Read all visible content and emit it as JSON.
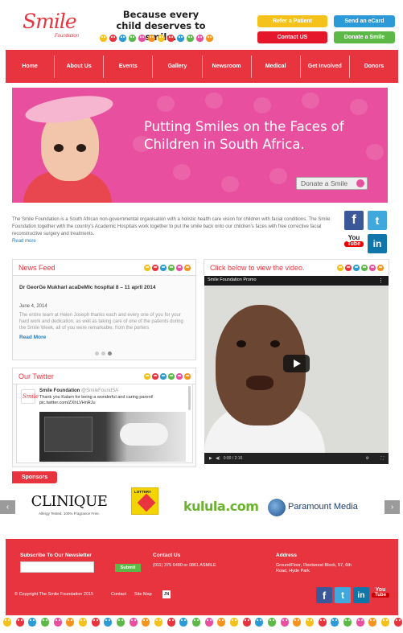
{
  "header": {
    "logo_text": "Smile",
    "logo_sub": "Foundation",
    "tagline": "Because every child deserves to smile.",
    "buttons": [
      {
        "label": "Refer a Patient",
        "color": "#f5c21b"
      },
      {
        "label": "Send an eCard",
        "color": "#2b9ad6"
      },
      {
        "label": "Contact US",
        "color": "#e5172b"
      },
      {
        "label": "Donate a Smile",
        "color": "#5cb947"
      }
    ]
  },
  "nav": {
    "items": [
      "Home",
      "About Us",
      "Events",
      "Gallery",
      "Newsroom",
      "Medical",
      "Get Involved",
      "Donors"
    ]
  },
  "banner": {
    "headline": "Putting Smiles on the Faces of Children in South Africa.",
    "donate_label": "Donate a Smile"
  },
  "intro": {
    "text": "The Smile Foundation is a South African non-governmental organisation with a holistic health care vision for children with facial conditions. The Smile Foundation together with the country's Academic Hospitals work together to put the smile back onto our children's faces with free corrective facial reconstructive surgery and treatments.",
    "read_more": "Read more"
  },
  "social": {
    "facebook": "f",
    "twitter": "t",
    "youtube_top": "You",
    "youtube_bottom": "Tube",
    "linkedin": "in"
  },
  "news_feed": {
    "title": "News Feed",
    "item_title": "Dr GeorGe MukharI acaDeMIc hospItal 8 – 11 aprIl 2014",
    "date": "June 4, 2014",
    "body": "The entire team at Helen Joseph thanks each and every one of you for your hard work and dedication, as well as taking care of one of the patients during the Smile Week, all of you were remarkable, from the porters",
    "read_more": "Read More"
  },
  "twitter": {
    "title": "Our Twitter",
    "account": "Smile Foundation",
    "handle": "@SmileFoundSA",
    "tweet": "Thank you Kalam for being a wonderful and caring parent! pic.twitter.com/ZXhLVHnRJu"
  },
  "video": {
    "panel_title": "Click below to view the video.",
    "video_title": "Smile Foundation Promo",
    "time": "0:00 / 2:16"
  },
  "sponsors": {
    "label": "Sponsors",
    "prev": "‹",
    "next": "›",
    "items": [
      {
        "name": "CLINIQUE",
        "sub": "Allergy Tested. 100% Fragrance Free."
      },
      {
        "name": "LOTTERY",
        "sub": ""
      },
      {
        "name": "kulula.com",
        "sub": ""
      },
      {
        "name": "Paramount Media",
        "sub": ""
      }
    ]
  },
  "footer": {
    "newsletter_title": "Subscribe To Our Newsletter",
    "submit_label": "Submit",
    "contact_title": "Contact Us",
    "contact_text": "(011) 375 6480 or 0861 ASMILE",
    "address_title": "Address",
    "address_text": "GroundFloor, Fleetwood Block, 57, 6th Road, Hyde Park",
    "copyright": "© Copyright The Smile Foundation 2015",
    "links": [
      "Contact",
      "Site Map"
    ]
  },
  "colors": {
    "brand_red": "#e8343e",
    "brand_pink": "#e94f9f",
    "face_palette": [
      "#f5c21b",
      "#e8343e",
      "#2b9ad6",
      "#5cb947",
      "#e94f9f",
      "#f7941d"
    ]
  }
}
